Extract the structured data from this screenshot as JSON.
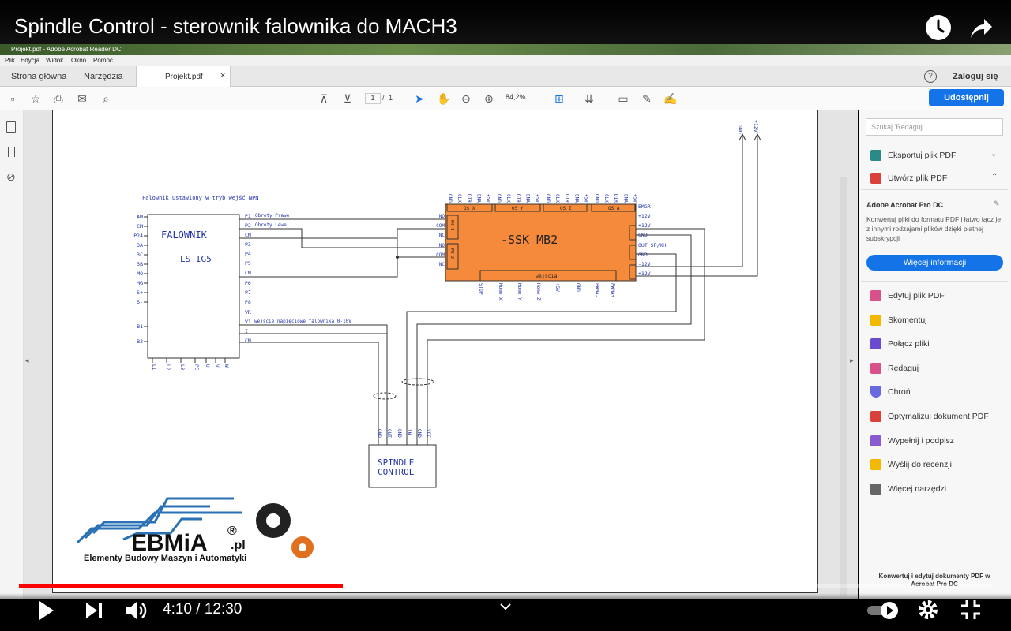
{
  "video": {
    "title": "Spindle Control - sterownik falownika do MACH3",
    "time_current": "4:10",
    "time_total": "12:30",
    "time_sep": " / ",
    "progress": 0.333,
    "buffered": 0.447
  },
  "window": {
    "title": "Projekt.pdf - Adobe Acrobat Reader DC"
  },
  "menu": [
    "Plik",
    "Edycja",
    "Widok",
    "Okno",
    "Pomoc"
  ],
  "tabs": {
    "home": "Strona główna",
    "tools": "Narzędzia",
    "doc": "Projekt.pdf",
    "close": "×",
    "login": "Zaloguj się"
  },
  "toolbar": {
    "page": "1",
    "page_sep": "/",
    "page_total": "1",
    "zoom": "84,2%",
    "share": "Udostępnij"
  },
  "panel": {
    "search_placeholder": "Szukaj 'Redaguj'",
    "export": "Eksportuj plik PDF",
    "create": "Utwórz plik PDF",
    "pro_title": "Adobe Acrobat Pro DC",
    "pro_desc": "Konwertuj pliki do formatu PDF i łatwo łącz je z innymi rodzajami plików dzięki płatnej subskrypcji",
    "more_info": "Więcej informacji",
    "tools": [
      "Edytuj plik PDF",
      "Skomentuj",
      "Połącz pliki",
      "Redaguj",
      "Chroń",
      "Optymalizuj dokument PDF",
      "Wypełnij i podpisz",
      "Wyślij do recenzji",
      "Więcej narzędzi"
    ],
    "footer": "Konwertuj i edytuj dokumenty PDF w Acrobat Pro DC"
  },
  "schematic": {
    "note": "Falownik ustawiony w tryb wejść NPN",
    "falownik": "FALOWNIK",
    "model": "LS IG5",
    "left_pins": [
      "AM",
      "CM",
      "P24",
      "3A",
      "3C",
      "3B",
      "MO",
      "MG",
      "S+",
      "S-",
      "B1",
      "B2"
    ],
    "right_pins": [
      "P1",
      "P2",
      "CM",
      "P3",
      "P4",
      "P5",
      "CM",
      "P6",
      "P7",
      "P8",
      "VR",
      "V1",
      "I",
      "CM"
    ],
    "p1_label": "Obroty Prawe",
    "p2_label": "Obroty Lewe",
    "v1_label": "wejście napięciowe falownika 0-10V",
    "bottom_pins": [
      "L1",
      "L2",
      "L3",
      "PE",
      "U",
      "V",
      "W"
    ],
    "ssk": "-SSK MB2",
    "ssk_top_groups": [
      "OS X",
      "OS Y",
      "OS Z",
      "OS A"
    ],
    "ssk_top_pins": [
      "GND",
      "CLK",
      "DIR",
      "ENA",
      "+5V",
      "GND",
      "CLK",
      "DIR",
      "ENA",
      "+5V",
      "GND",
      "CLK",
      "DIR",
      "ENA",
      "+5V",
      "GND",
      "CLK",
      "DIR",
      "ENA",
      "+5V"
    ],
    "ssk_right": [
      "EMGR",
      "+12V",
      "+12V",
      "GND",
      "OUT SP/KH",
      "GND",
      "-12V",
      "+12V"
    ],
    "ssk_left": [
      "NO",
      "COM",
      "NC",
      "NO",
      "COM",
      "NC"
    ],
    "pk1": "PK 1",
    "pk2": "PK 2",
    "wejscia": "wejścia",
    "ssk_bottom": [
      "STOP",
      "Home X",
      "Home Y",
      "Home Z",
      "+5V",
      "GND",
      "PWMA-",
      "PWMA+"
    ],
    "top_right": [
      "GND",
      "+12V"
    ],
    "spindle": [
      "SPINDLE",
      "CONTROL"
    ],
    "spindle_pins": [
      "GND",
      "OUT",
      "GND",
      "IN",
      "GND",
      "VCC"
    ]
  },
  "logo": {
    "name": "EBMiA",
    "suffix": ".pl",
    "reg": "®",
    "tagline": "Elementy Budowy Maszyn i Automatyki"
  },
  "icons": [
    "clock-icon",
    "share-arrow-icon",
    "play-icon",
    "next-icon",
    "volume-icon",
    "settings-icon",
    "exit-fullscreen-icon",
    "chevron-down-icon"
  ]
}
